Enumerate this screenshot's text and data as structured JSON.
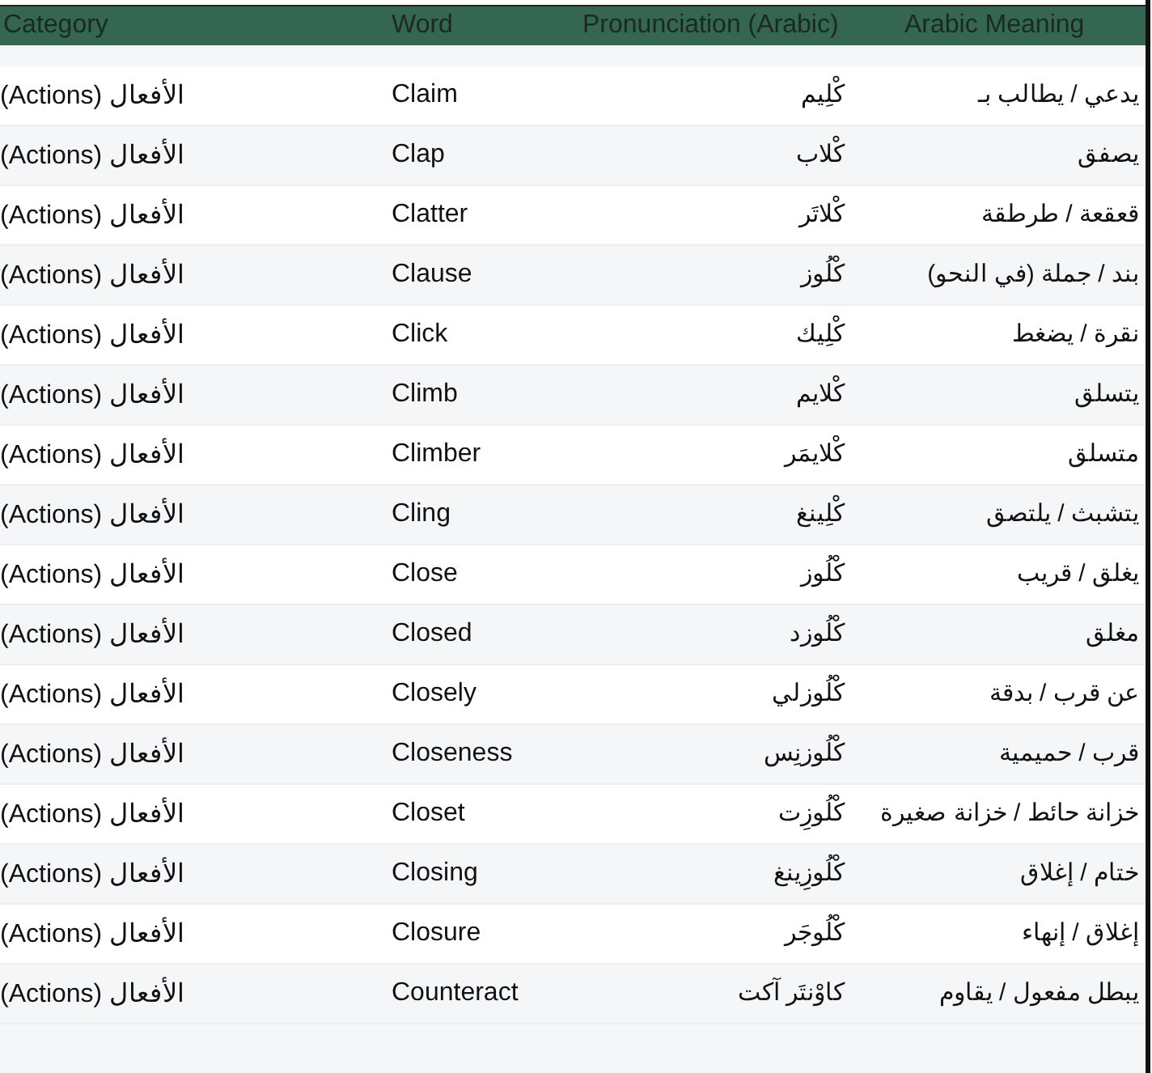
{
  "table": {
    "header": {
      "category": "Category",
      "word": "Word",
      "pronunciation": "Pronunciation (Arabic)",
      "meaning": "Arabic Meaning"
    },
    "rows": [
      {
        "category": "(Actions) الأفعال",
        "word": "Claim",
        "pronunciation": "كْلِيم",
        "meaning": "يدعي / يطالب بـ"
      },
      {
        "category": "(Actions) الأفعال",
        "word": "Clap",
        "pronunciation": "كْلاب",
        "meaning": "يصفق"
      },
      {
        "category": "(Actions) الأفعال",
        "word": "Clatter",
        "pronunciation": "كْلاتَر",
        "meaning": "قعقعة / طرطقة"
      },
      {
        "category": "(Actions) الأفعال",
        "word": "Clause",
        "pronunciation": "كْلُوز",
        "meaning": "بند / جملة (في النحو)"
      },
      {
        "category": "(Actions) الأفعال",
        "word": "Click",
        "pronunciation": "كْلِيك",
        "meaning": "نقرة / يضغط"
      },
      {
        "category": "(Actions) الأفعال",
        "word": "Climb",
        "pronunciation": "كْلايم",
        "meaning": "يتسلق"
      },
      {
        "category": "(Actions) الأفعال",
        "word": "Climber",
        "pronunciation": "كْلايمَر",
        "meaning": "متسلق"
      },
      {
        "category": "(Actions) الأفعال",
        "word": "Cling",
        "pronunciation": "كْلِينغ",
        "meaning": "يتشبث / يلتصق"
      },
      {
        "category": "(Actions) الأفعال",
        "word": "Close",
        "pronunciation": "كْلُوز",
        "meaning": "يغلق / قريب"
      },
      {
        "category": "(Actions) الأفعال",
        "word": "Closed",
        "pronunciation": "كْلُوزد",
        "meaning": "مغلق"
      },
      {
        "category": "(Actions) الأفعال",
        "word": "Closely",
        "pronunciation": "كْلُوزلي",
        "meaning": "عن قرب / بدقة"
      },
      {
        "category": "(Actions) الأفعال",
        "word": "Closeness",
        "pronunciation": "كْلُوزنِس",
        "meaning": "قرب / حميمية"
      },
      {
        "category": "(Actions) الأفعال",
        "word": "Closet",
        "pronunciation": "كْلُوزِت",
        "meaning": "خزانة حائط / خزانة صغيرة"
      },
      {
        "category": "(Actions) الأفعال",
        "word": "Closing",
        "pronunciation": "كْلُوزِينغ",
        "meaning": "ختام / إغلاق"
      },
      {
        "category": "(Actions) الأفعال",
        "word": "Closure",
        "pronunciation": "كْلُوجَر",
        "meaning": "إغلاق / إنهاء"
      },
      {
        "category": "(Actions) الأفعال",
        "word": "Counteract",
        "pronunciation": "كاوْنتَر آكت",
        "meaning": "يبطل مفعول / يقاوم"
      }
    ]
  }
}
